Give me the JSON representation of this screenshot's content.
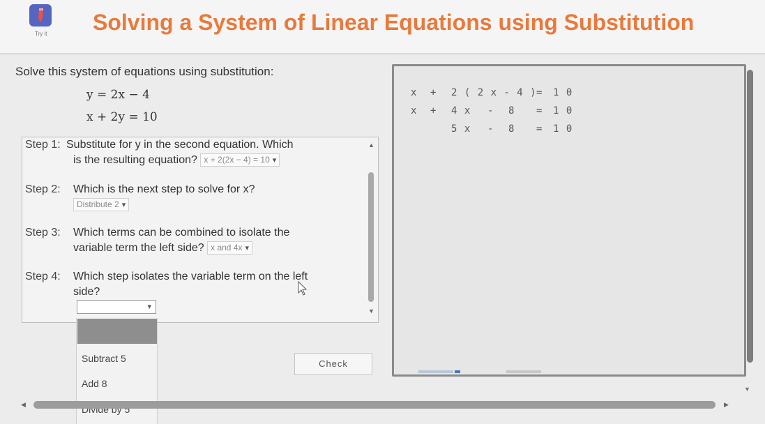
{
  "header": {
    "title": "Solving a System of Linear Equations using Substitution",
    "logo_caption": "Try it",
    "logo_icon": "pencil-icon",
    "title_color": "#e87a3c",
    "logo_color": "#5566c0"
  },
  "problem": {
    "prompt": "Solve this system of equations using substitution:",
    "equation_1": "y = 2x − 4",
    "equation_2": "x + 2y = 10"
  },
  "steps": {
    "step1": {
      "label": "Step 1:",
      "text_line1": "Substitute for y in the second equation. Which",
      "text_line2": "is the resulting equation?",
      "selected": "x + 2(2x − 4) = 10"
    },
    "step2": {
      "label": "Step 2:",
      "text": "Which is the next step to solve for x?",
      "selected": "Distribute 2"
    },
    "step3": {
      "label": "Step 3:",
      "text_line1": "Which terms can be combined to isolate the",
      "text_line2": "variable term the left side?",
      "selected": "x and 4x"
    },
    "step4": {
      "label": "Step 4:",
      "text_line1": "Which step isolates the variable term on the left",
      "text_line2": "side?",
      "selected": ""
    }
  },
  "dropdown": {
    "options": [
      "Subtract 5",
      "Add 8",
      "Divide by 5"
    ]
  },
  "check_button": "Check",
  "work": {
    "row1": [
      "x",
      "+",
      "2 ( 2 x - 4 )",
      "=",
      "1 0"
    ],
    "row2": [
      "x",
      "+",
      "4 x",
      "-",
      "8",
      "=",
      "1 0"
    ],
    "row3": [
      "5 x",
      "-",
      "8",
      "=",
      "1 0"
    ]
  }
}
